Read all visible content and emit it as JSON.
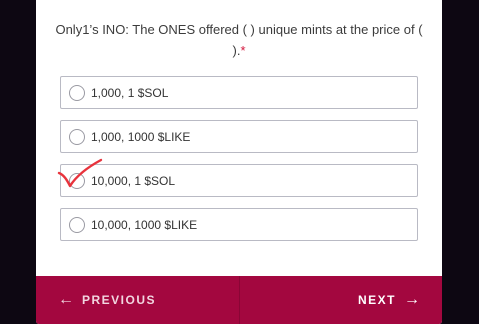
{
  "question": {
    "text": "Only1’s INO: The ONES offered (   ) unique mints at the price of (   ).",
    "required_mark": "*"
  },
  "options": [
    {
      "label": "1,000, 1 $SOL"
    },
    {
      "label": "1,000, 1000 $LIKE"
    },
    {
      "label": "10,000, 1 $SOL"
    },
    {
      "label": "10,000, 1000 $LIKE"
    }
  ],
  "annotation": {
    "marked_option_index": 2,
    "mark_color": "#e8333c"
  },
  "footer": {
    "previous_label": "PREVIOUS",
    "next_label": "NEXT",
    "background_color": "#a3073f"
  },
  "icons": {
    "previous": "arrow-left-icon",
    "next": "arrow-right-icon",
    "mark": "red-checkmark-icon"
  }
}
